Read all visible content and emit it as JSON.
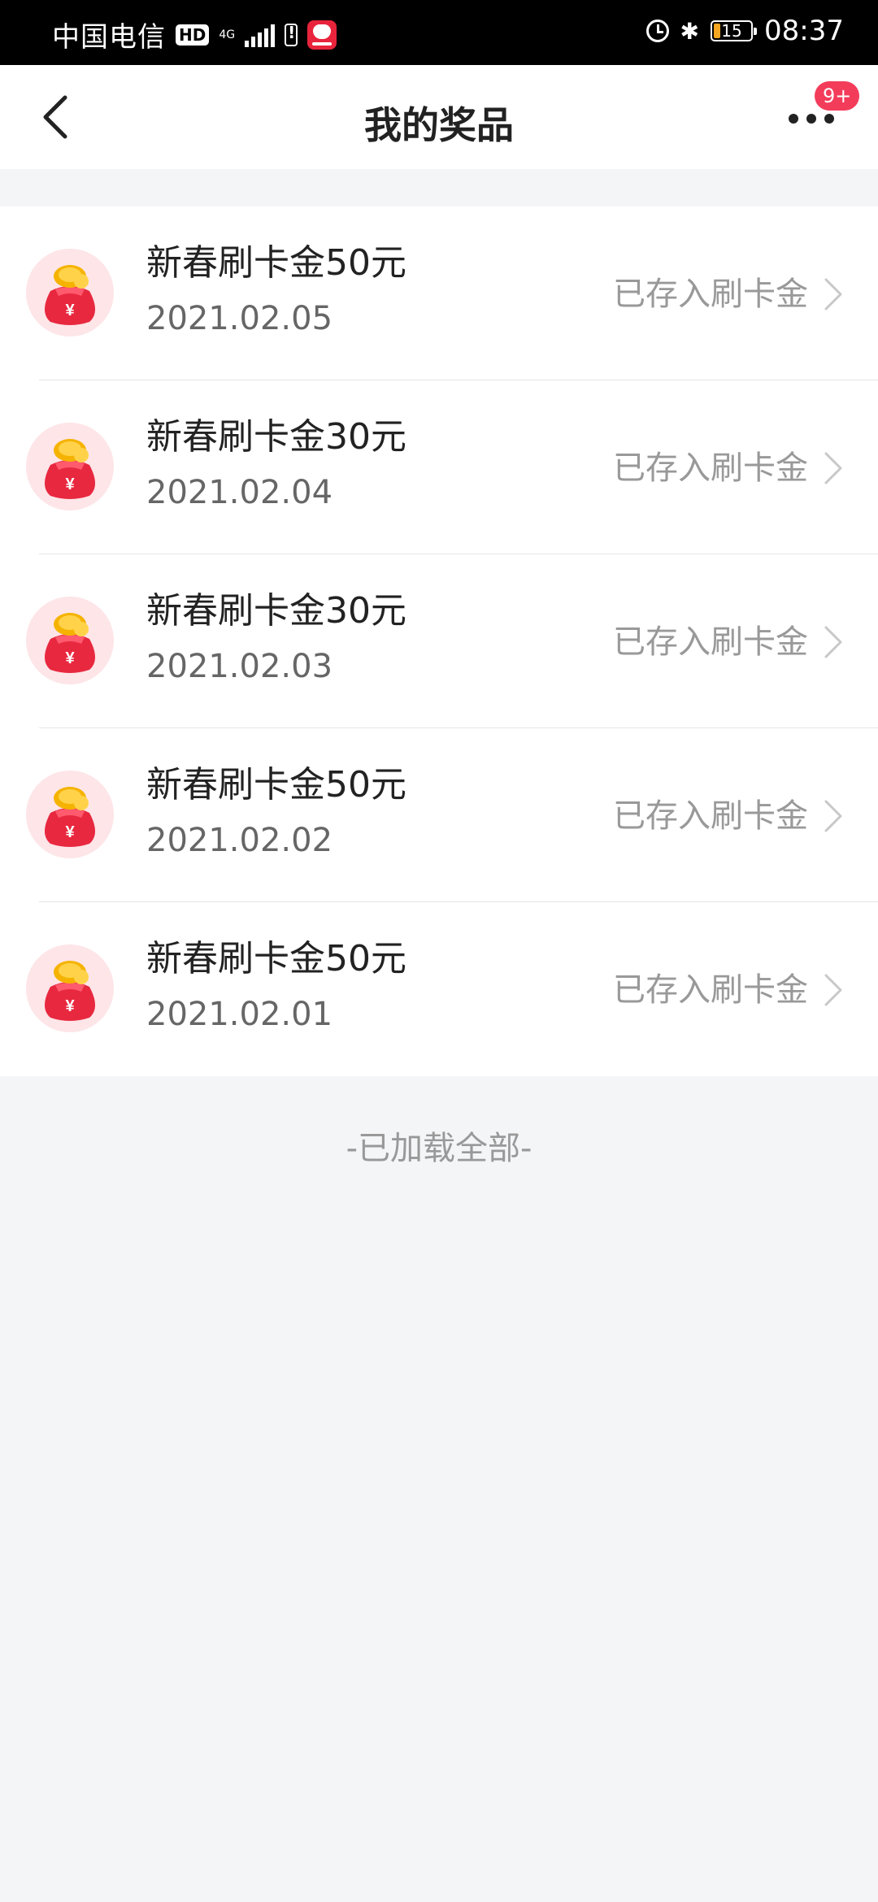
{
  "status_bar": {
    "carrier": "中国电信",
    "hd": "HD",
    "net": "4G",
    "battery": "15",
    "time": "08:37"
  },
  "header": {
    "title": "我的奖品",
    "badge": "9+"
  },
  "prizes": [
    {
      "name": "新春刷卡金50元",
      "date": "2021.02.05",
      "status": "已存入刷卡金"
    },
    {
      "name": "新春刷卡金30元",
      "date": "2021.02.04",
      "status": "已存入刷卡金"
    },
    {
      "name": "新春刷卡金30元",
      "date": "2021.02.03",
      "status": "已存入刷卡金"
    },
    {
      "name": "新春刷卡金50元",
      "date": "2021.02.02",
      "status": "已存入刷卡金"
    },
    {
      "name": "新春刷卡金50元",
      "date": "2021.02.01",
      "status": "已存入刷卡金"
    }
  ],
  "footer": "-已加载全部-",
  "icons": {
    "back": "back-arrow-icon",
    "more": "more-dots-icon",
    "prize": "red-envelope-money-bag-icon",
    "chevron": "chevron-right-icon"
  },
  "colors": {
    "accent": "#f33c5a",
    "status_text": "#999999",
    "background": "#f4f5f7"
  }
}
